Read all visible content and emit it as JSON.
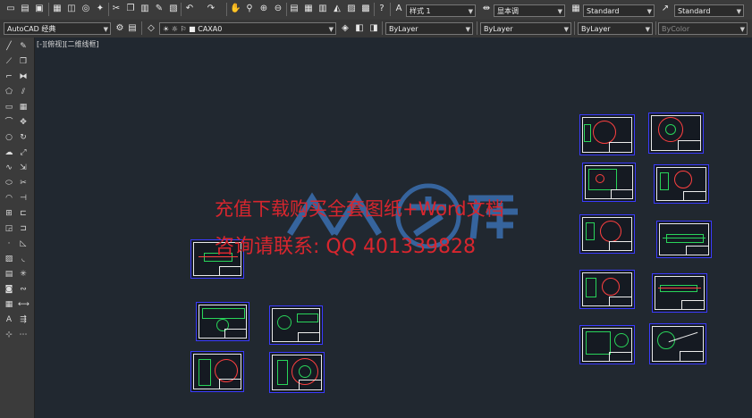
{
  "toolbar_top": {
    "text_style": "样式 1",
    "dim_style": "显本调",
    "table_style": "Standard",
    "multileader_style": "Standard"
  },
  "toolbar_second": {
    "workspace": "AutoCAD 经典",
    "layer": "CAXA0",
    "color": "ByLayer",
    "linetype": "ByLayer",
    "lineweight": "ByLayer",
    "plotstyle": "ByColor"
  },
  "viewport": {
    "label": "[-][俯视][二维线框]"
  },
  "watermark": {
    "line1": "充值下载购买全套图纸+Word文档",
    "line2": "咨询请联系: QQ 401339828",
    "logo_text": "人人文库"
  },
  "colors": {
    "canvas_bg": "#212830",
    "sheet_border": "#3b3bff",
    "drawing_red": "#ff4040",
    "drawing_green": "#29d45a",
    "watermark_red": "#d8262e",
    "logo_blue": "#3a6fb0"
  }
}
